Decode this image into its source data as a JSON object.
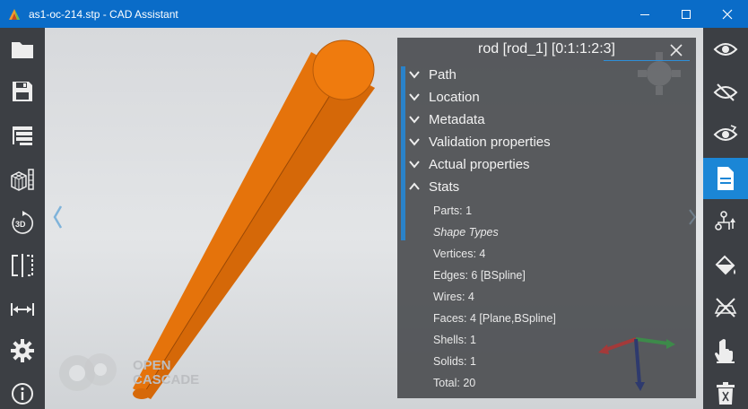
{
  "window": {
    "title": "as1-oc-214.stp - CAD Assistant"
  },
  "left_toolbar": {
    "icons": [
      "folder-icon",
      "save-icon",
      "tree-icon",
      "cube-grid-icon",
      "rotate-3d-icon",
      "section-icon",
      "measure-icon",
      "settings-icon",
      "info-icon"
    ]
  },
  "right_toolbar": {
    "icons": [
      "eye-icon",
      "eye-off-icon",
      "eye-rotate-icon",
      "document-icon",
      "explode-icon",
      "paint-bucket-icon",
      "no-selection-icon",
      "hand-pointer-icon",
      "trash-icon"
    ],
    "active_index": 3
  },
  "rotate_icon_label": "3D",
  "panel": {
    "title": "rod [rod_1] [0:1:1:2:3]",
    "sections": [
      {
        "label": "Path",
        "expanded": false
      },
      {
        "label": "Location",
        "expanded": false
      },
      {
        "label": "Metadata",
        "expanded": false
      },
      {
        "label": "Validation properties",
        "expanded": false
      },
      {
        "label": "Actual properties",
        "expanded": false
      },
      {
        "label": "Stats",
        "expanded": true
      }
    ],
    "stats": [
      {
        "text": "Parts: 1",
        "italic": false
      },
      {
        "text": "Shape Types",
        "italic": true
      },
      {
        "text": "Vertices: 4",
        "italic": false
      },
      {
        "text": "Edges: 6 [BSpline]",
        "italic": false
      },
      {
        "text": "Wires: 4",
        "italic": false
      },
      {
        "text": "Faces: 4 [Plane,BSpline]",
        "italic": false
      },
      {
        "text": "Shells: 1",
        "italic": false
      },
      {
        "text": "Solids: 1",
        "italic": false
      },
      {
        "text": "Total: 20",
        "italic": false
      }
    ]
  },
  "watermark": {
    "line1": "OPEN",
    "line2": "CASCADE"
  },
  "colors": {
    "titlebar": "#0a6cc8",
    "toolbar": "#3c3f44",
    "accent": "#1b86d6",
    "rod": "#e8740c"
  }
}
